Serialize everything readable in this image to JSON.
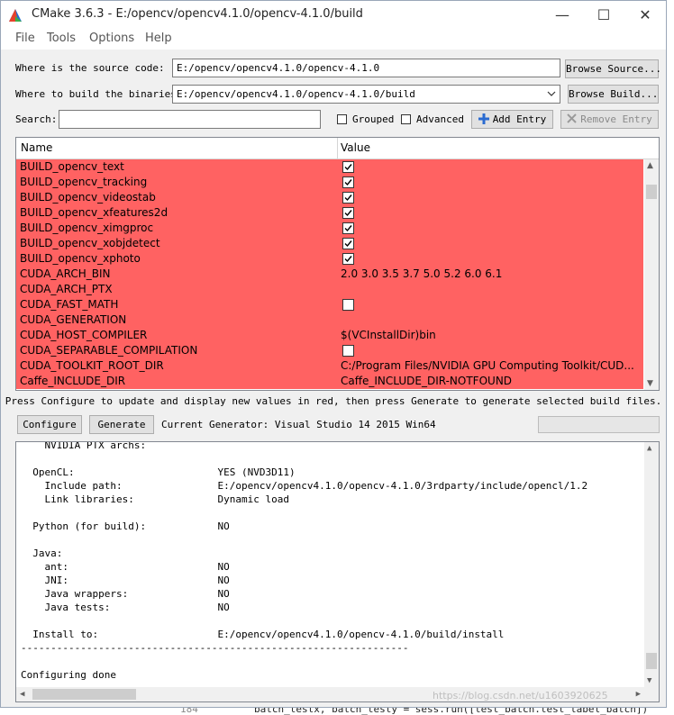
{
  "window": {
    "title": "CMake 3.6.3 - E:/opencv/opencv4.1.0/opencv-4.1.0/build",
    "controls": [
      "—",
      "☐",
      "✕"
    ]
  },
  "menu": [
    "File",
    "Tools",
    "Options",
    "Help"
  ],
  "source": {
    "label": "Where is the source code:",
    "value": "E:/opencv/opencv4.1.0/opencv-4.1.0",
    "browse_label": "Browse Source..."
  },
  "build": {
    "label": "Where to build the binaries:",
    "value": "E:/opencv/opencv4.1.0/opencv-4.1.0/build",
    "browse_label": "Browse Build..."
  },
  "search": {
    "label": "Search:",
    "value": "",
    "grouped_label": "Grouped",
    "grouped_checked": false,
    "advanced_label": "Advanced",
    "advanced_checked": false,
    "add_entry_label": "Add Entry",
    "remove_entry_label": "Remove Entry"
  },
  "table": {
    "headers": {
      "name": "Name",
      "value": "Value"
    },
    "row_color": "#ff6262",
    "rows": [
      {
        "name": "BUILD_opencv_text",
        "type": "bool",
        "checked": true
      },
      {
        "name": "BUILD_opencv_tracking",
        "type": "bool",
        "checked": true
      },
      {
        "name": "BUILD_opencv_videostab",
        "type": "bool",
        "checked": true
      },
      {
        "name": "BUILD_opencv_xfeatures2d",
        "type": "bool",
        "checked": true
      },
      {
        "name": "BUILD_opencv_ximgproc",
        "type": "bool",
        "checked": true
      },
      {
        "name": "BUILD_opencv_xobjdetect",
        "type": "bool",
        "checked": true
      },
      {
        "name": "BUILD_opencv_xphoto",
        "type": "bool",
        "checked": true
      },
      {
        "name": "CUDA_ARCH_BIN",
        "type": "text",
        "value": "2.0 3.0 3.5 3.7 5.0 5.2 6.0 6.1"
      },
      {
        "name": "CUDA_ARCH_PTX",
        "type": "text",
        "value": ""
      },
      {
        "name": "CUDA_FAST_MATH",
        "type": "bool",
        "checked": false
      },
      {
        "name": "CUDA_GENERATION",
        "type": "text",
        "value": ""
      },
      {
        "name": "CUDA_HOST_COMPILER",
        "type": "text",
        "value": "$(VCInstallDir)bin"
      },
      {
        "name": "CUDA_SEPARABLE_COMPILATION",
        "type": "bool",
        "checked": false
      },
      {
        "name": "CUDA_TOOLKIT_ROOT_DIR",
        "type": "text",
        "value": "C:/Program Files/NVIDIA GPU Computing Toolkit/CUD..."
      },
      {
        "name": "Caffe_INCLUDE_DIR",
        "type": "text",
        "value": "Caffe_INCLUDE_DIR-NOTFOUND"
      }
    ]
  },
  "hint": "Press Configure to update and display new values in red, then press Generate to generate selected build files.",
  "actions": {
    "configure_label": "Configure",
    "generate_label": "Generate",
    "generator_text": "Current Generator: Visual Studio 14 2015 Win64"
  },
  "output_lines": [
    "    NVIDIA PTX archs:",
    "",
    "  OpenCL:                        YES (NVD3D11)",
    "    Include path:                E:/opencv/opencv4.1.0/opencv-4.1.0/3rdparty/include/opencl/1.2",
    "    Link libraries:              Dynamic load",
    "",
    "  Python (for build):            NO",
    "",
    "  Java:",
    "    ant:                         NO",
    "    JNI:                         NO",
    "    Java wrappers:               NO",
    "    Java tests:                  NO",
    "",
    "  Install to:                    E:/opencv/opencv4.1.0/opencv-4.1.0/build/install",
    "-----------------------------------------------------------------",
    "",
    "Configuring done"
  ],
  "background": {
    "line_number": "184",
    "code_text": "batch_testx, batch_testy = sess.run([test_batch.test_label_batch])",
    "watermark": "https://blog.csdn.net/u1603920625"
  }
}
